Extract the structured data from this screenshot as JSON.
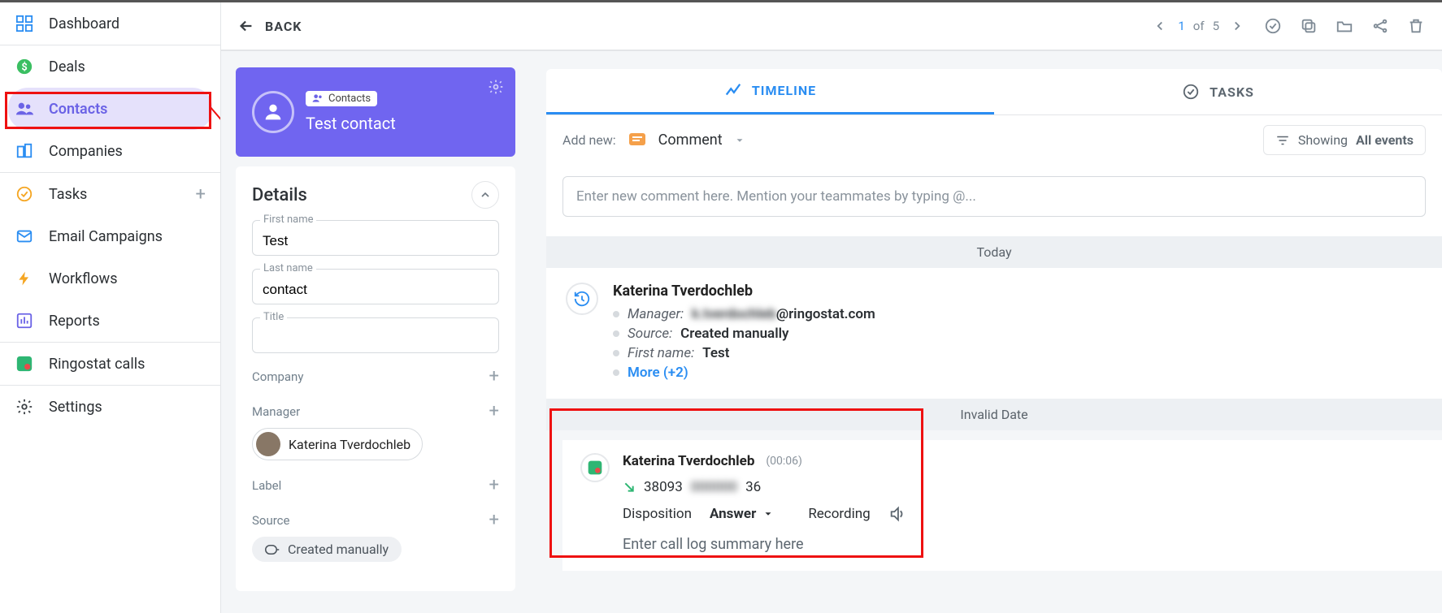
{
  "sidebar": {
    "items": [
      {
        "label": "Dashboard"
      },
      {
        "label": "Deals"
      },
      {
        "label": "Contacts"
      },
      {
        "label": "Companies"
      },
      {
        "label": "Tasks"
      },
      {
        "label": "Email Campaigns"
      },
      {
        "label": "Workflows"
      },
      {
        "label": "Reports"
      },
      {
        "label": "Ringostat calls"
      },
      {
        "label": "Settings"
      }
    ]
  },
  "topbar": {
    "back": "BACK",
    "pager_prefix": "1",
    "pager_middle": " of ",
    "pager_total": "5"
  },
  "contact_card": {
    "chip_label": "Contacts",
    "name": "Test contact"
  },
  "details": {
    "heading": "Details",
    "first_name_label": "First name",
    "first_name": "Test",
    "last_name_label": "Last name",
    "last_name": "contact",
    "title_label": "Title",
    "title": "",
    "company_label": "Company",
    "manager_label": "Manager",
    "manager": "Katerina Tverdochleb",
    "label_label": "Label",
    "source_label": "Source",
    "source": "Created manually"
  },
  "tabs": {
    "timeline": "TIMELINE",
    "tasks": "TASKS"
  },
  "addrow": {
    "addnew": "Add new:",
    "comment": "Comment",
    "filter_prefix": "Showing ",
    "filter_value": "All events"
  },
  "comment_placeholder": "Enter new comment here. Mention your teammates by typing @...",
  "divider_today": "Today",
  "entry1": {
    "name": "Katerina Tverdochleb",
    "manager_k": "Manager:",
    "manager_v_blur": "k.tverdochleb",
    "manager_v_tail": "@ringostat.com",
    "source_k": "Source:",
    "source_v": "Created manually",
    "firstname_k": "First name:",
    "firstname_v": "Test",
    "more": "More (+2)"
  },
  "divider_invalid": "Invalid Date",
  "call": {
    "name": "Katerina Tverdochleb",
    "duration": "(00:06)",
    "number_prefix": "38093",
    "number_blur": "000000",
    "number_tail": "36",
    "disposition_label": "Disposition",
    "disposition_value": "Answer",
    "recording_label": "Recording",
    "summary_ph": "Enter call log summary here"
  }
}
